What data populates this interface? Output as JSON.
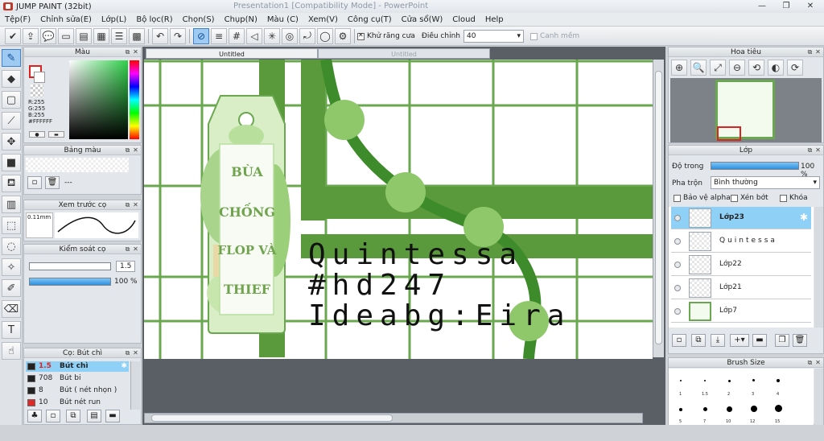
{
  "title": "JUMP PAINT (32bit)",
  "ghost_title": "Presentation1 [Compatibility Mode] - PowerPoint",
  "menu": [
    "Tệp(F)",
    "Chỉnh sửa(E)",
    "Lớp(L)",
    "Bộ lọc(R)",
    "Chọn(S)",
    "Chụp(N)",
    "Màu (C)",
    "Xem(V)",
    "Công cụ(T)",
    "Cửa sổ(W)",
    "Cloud",
    "Help"
  ],
  "toolbar": {
    "antialias": "Khử răng cưa",
    "adjust": "Điều chỉnh",
    "adjust_value": "40",
    "edge": "Canh mềm"
  },
  "panels": {
    "color": {
      "title": "Màu",
      "rgb": "R:255\nG:255\nB:255\n#FFFFFF"
    },
    "palette": {
      "title": "Bảng màu",
      "none": "---"
    },
    "brush_preview": {
      "title": "Xem trước cọ",
      "size": "0.11mm"
    },
    "brush_control": {
      "title": "Kiểm soát cọ",
      "size": "1.5",
      "opacity": "100 %"
    },
    "brush_list": {
      "title": "Cọ: Bút chì",
      "items": [
        {
          "size": "1.5",
          "name": "Bút chì",
          "color": "#222222"
        },
        {
          "size": "708",
          "name": "Bút bi",
          "color": "#222222"
        },
        {
          "size": "8",
          "name": "Bút ( nét nhọn )",
          "color": "#222222"
        },
        {
          "size": "10",
          "name": "Bút nét run",
          "color": "#e02a2a"
        }
      ]
    },
    "navigator": {
      "title": "Hoa tiêu"
    },
    "layer": {
      "title": "Lớp",
      "opacity_label": "Độ trong",
      "opacity": "100 %",
      "blend_label": "Pha trộn",
      "blend": "Bình thường",
      "protect_alpha": "Bảo vệ alpha",
      "clip": "Xén bớt",
      "lock": "Khóa",
      "layers": [
        "Lớp23",
        "Quintessa",
        "Lớp22",
        "Lớp21",
        "Lớp7"
      ]
    },
    "brush_size": {
      "title": "Brush Size",
      "sizes": [
        "1",
        "1.5",
        "2",
        "3",
        "4",
        "5",
        "7",
        "10",
        "12",
        "15"
      ]
    }
  },
  "canvas": {
    "tab_active": "Untitled",
    "tab_inactive": "Untitled",
    "text_lines": [
      "Quintessa",
      "#hd247",
      "Ideabg:Eira"
    ],
    "tag_text": [
      "BÙA",
      "CHỐNG",
      "FLOP VÀ",
      "THIEF"
    ]
  },
  "colors": {
    "accent": "#3e83c9",
    "green": "#6aa84f",
    "dark_green": "#3d8b2a",
    "light_green": "#9ccf7a"
  }
}
